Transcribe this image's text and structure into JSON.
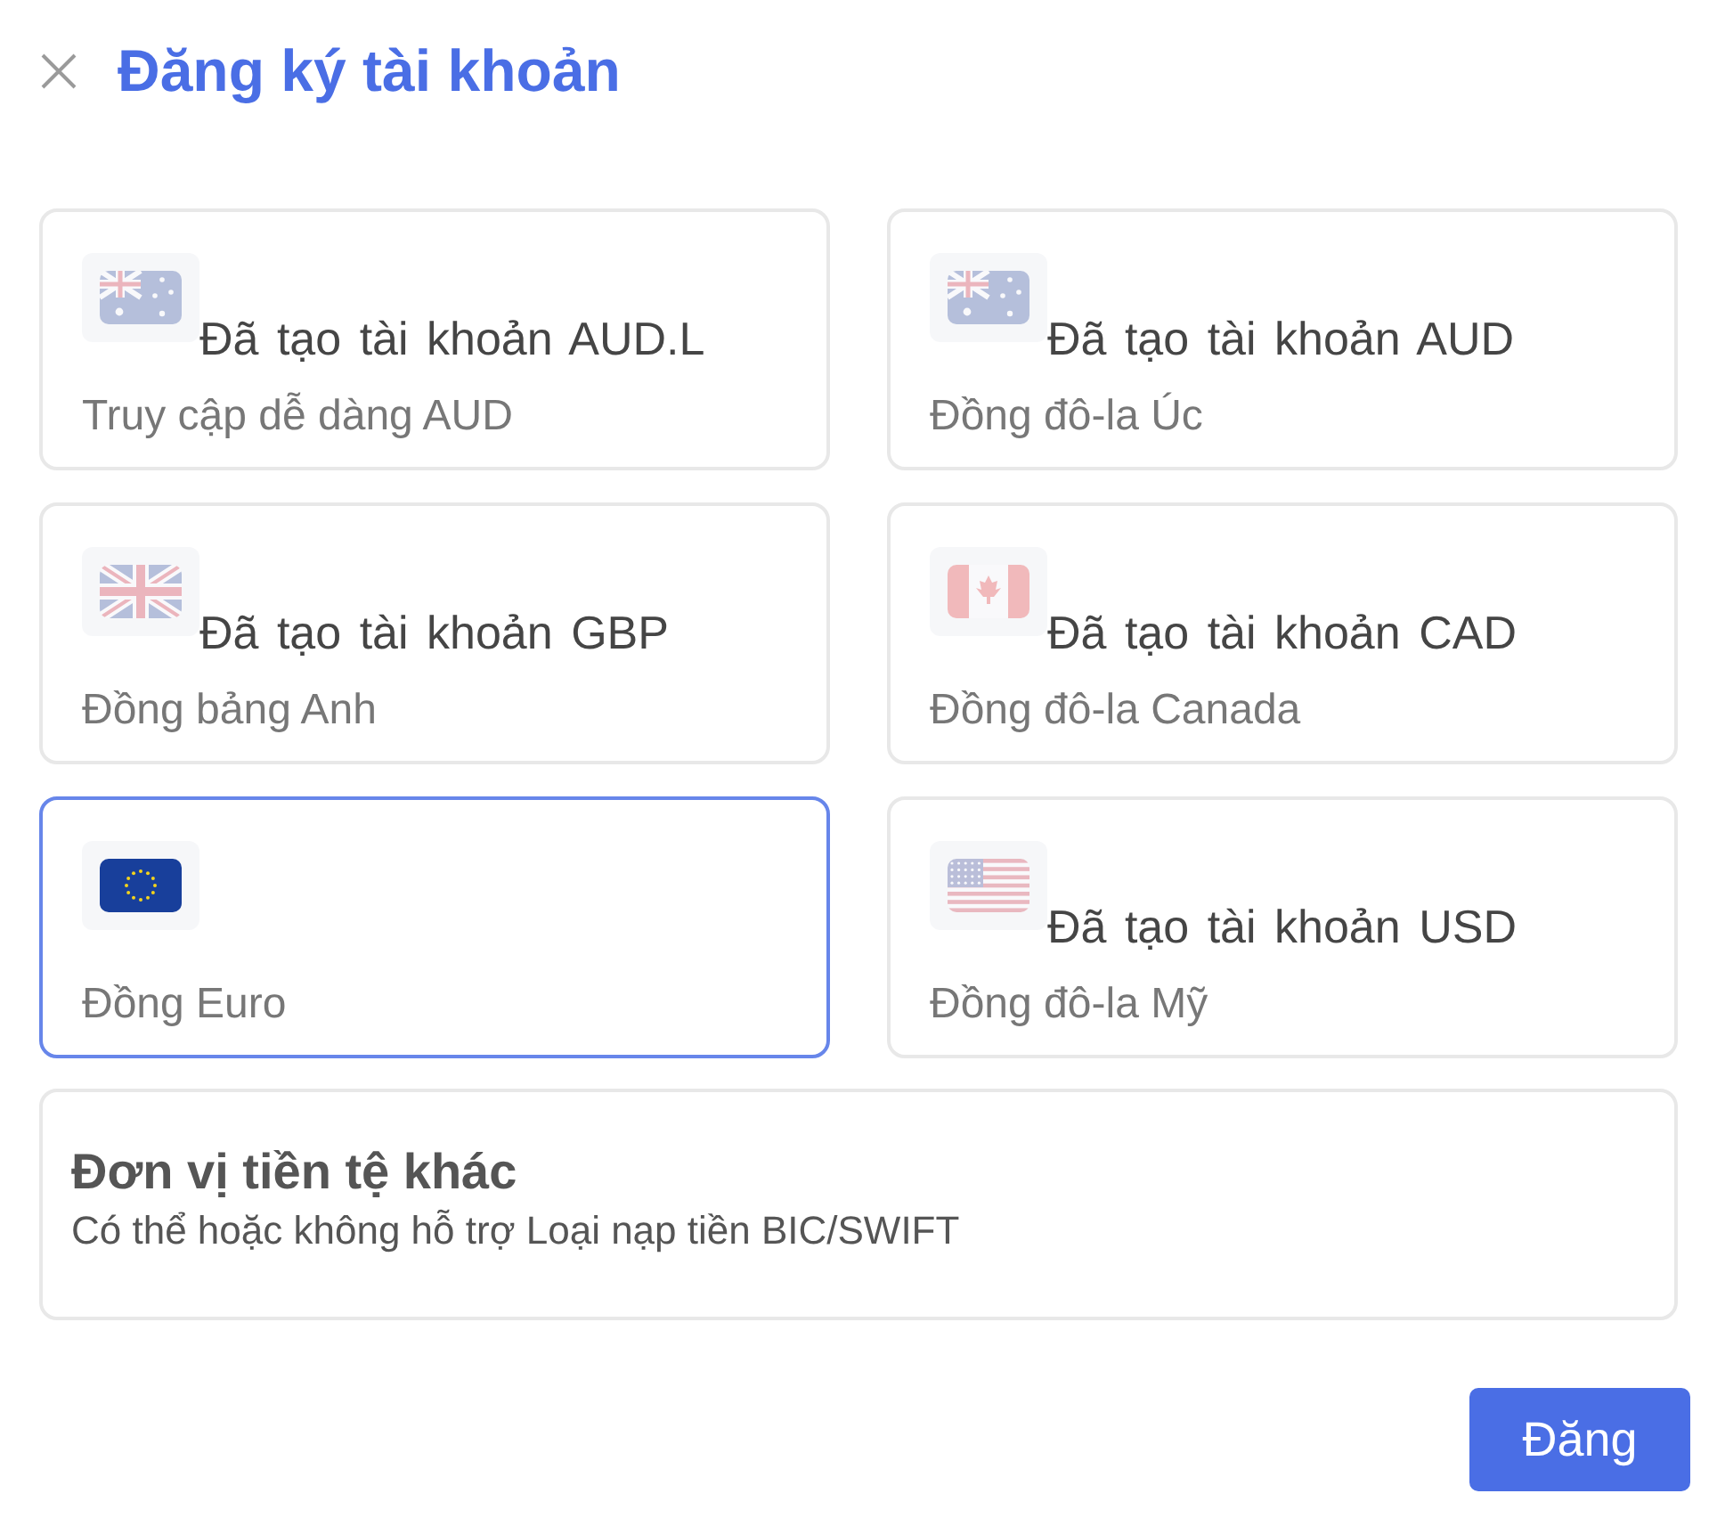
{
  "dialog": {
    "title": "Đăng ký tài khoản"
  },
  "currencies": [
    {
      "kind": "au",
      "status": "Đã tạo tài khoản AUD.L",
      "name": "Truy cập dễ dàng AUD",
      "disabled": true,
      "selected": false
    },
    {
      "kind": "gb",
      "status": "Đã tạo tài khoản GBP",
      "name": "Đồng bảng Anh",
      "disabled": true,
      "selected": false
    },
    {
      "kind": "eu",
      "name": "Đồng Euro",
      "disabled": false,
      "selected": true
    },
    {
      "kind": "au",
      "status": "Đã tạo tài khoản AUD",
      "name": "Đồng đô-la Úc",
      "disabled": true,
      "selected": false
    },
    {
      "kind": "ca",
      "status": "Đã tạo tài khoản CAD",
      "name": "Đồng đô-la Canada",
      "disabled": true,
      "selected": false
    },
    {
      "kind": "us",
      "status": "Đã tạo tài khoản USD",
      "name": "Đồng đô-la Mỹ",
      "disabled": true,
      "selected": false
    }
  ],
  "other_currency": {
    "title": "Đơn vị tiền tệ khác",
    "description": "Có thể hoặc không hỗ trợ Loại nạp tiền BIC/SWIFT",
    "selected": false
  },
  "submit_button": "Đăng"
}
